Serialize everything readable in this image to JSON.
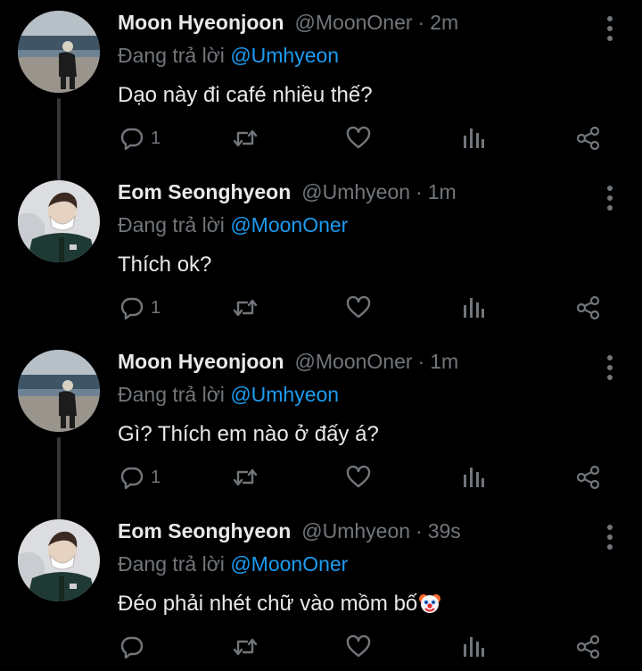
{
  "theme": {
    "background": "#000000",
    "text": "#e7e9ea",
    "muted": "#71767b",
    "link": "#1d9bf0"
  },
  "replying_prefix": "Đang trả lời",
  "tweets": [
    {
      "display_name": "Moon Hyeonjoon",
      "handle": "@MoonOner",
      "separator": "·",
      "time": "2m",
      "reply_to": "@Umhyeon",
      "text": "Dạo này đi café nhiều thế?",
      "reply_count": "1",
      "avatar": "beach-photo",
      "icons": [
        "reply-icon",
        "retweet-icon",
        "like-icon",
        "stats-icon",
        "share-icon",
        "more-icon"
      ]
    },
    {
      "display_name": "Eom Seonghyeon",
      "handle": "@Umhyeon",
      "separator": "·",
      "time": "1m",
      "reply_to": "@MoonOner",
      "text": "Thích ok?",
      "reply_count": "1",
      "avatar": "masked-person-photo"
    },
    {
      "display_name": "Moon Hyeonjoon",
      "handle": "@MoonOner",
      "separator": "·",
      "time": "1m",
      "reply_to": "@Umhyeon",
      "text": "Gì? Thích em nào ở đấy á?",
      "reply_count": "1",
      "avatar": "beach-photo"
    },
    {
      "display_name": "Eom Seonghyeon",
      "handle": "@Umhyeon",
      "separator": "·",
      "time": "39s",
      "reply_to": "@MoonOner",
      "text": "Đéo phải nhét chữ vào mồm bố",
      "reply_count": "",
      "avatar": "masked-person-photo",
      "trailing_emoji": "clown-face-icon"
    }
  ]
}
